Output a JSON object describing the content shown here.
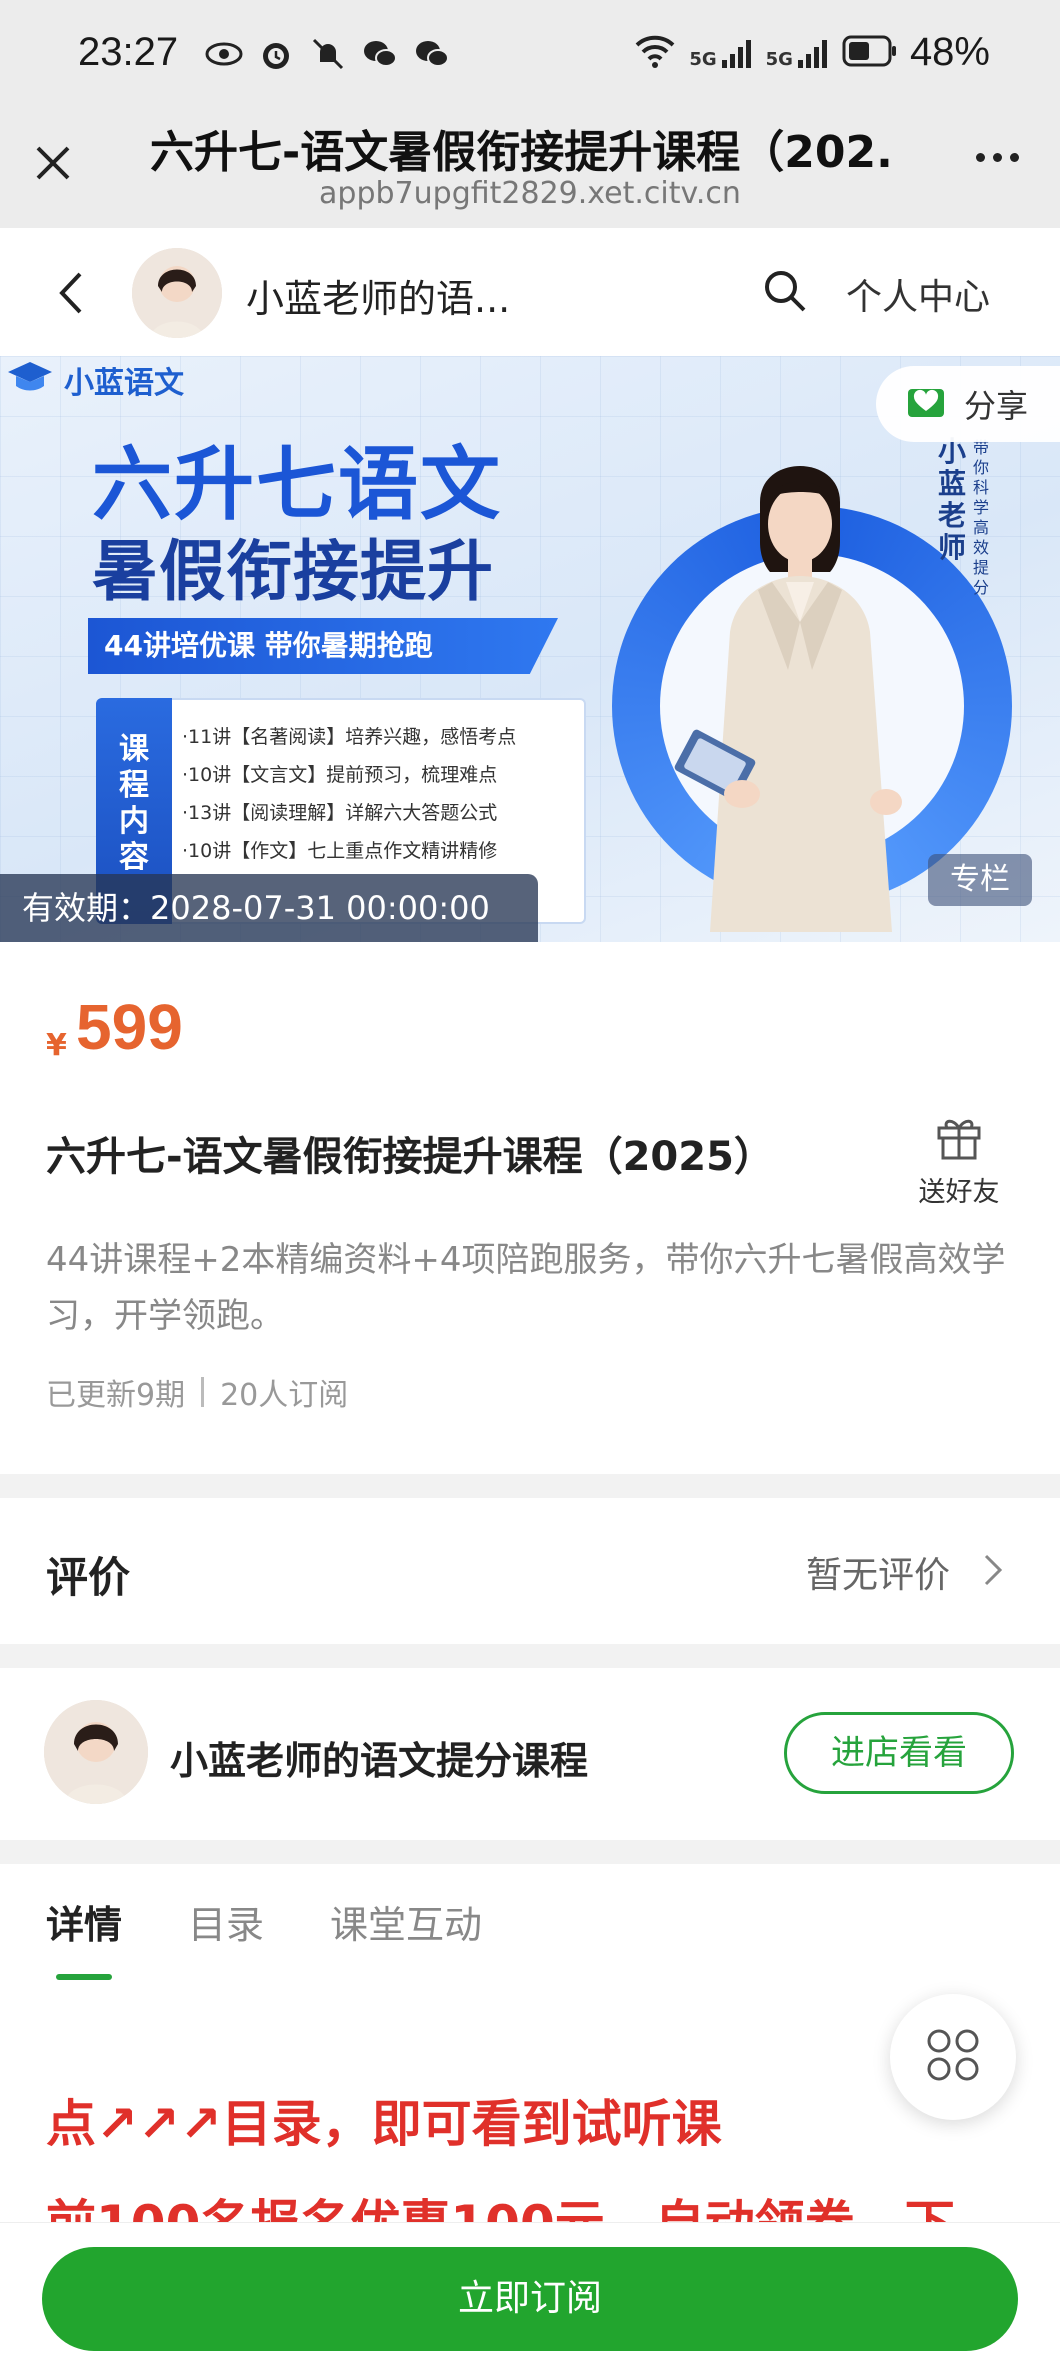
{
  "status_bar": {
    "time": "23:27",
    "battery": "48%",
    "network1": "5G",
    "network2": "5G"
  },
  "browser": {
    "title": "六升七-语文暑假衔接提升课程（202...",
    "url": "appb7upgfit2829.xet.citv.cn"
  },
  "shop_header": {
    "shop_name": "小蓝老师的语...",
    "personal_center": "个人中心"
  },
  "banner": {
    "brand": "小蓝语文",
    "title_line1": "六升七语文",
    "title_line2": "暑假衔接提升",
    "ribbon": "44讲培优课  带你暑期抢跑",
    "content_tab": "课程内容",
    "content_items": [
      "·11讲【名著阅读】培养兴趣，感悟考点",
      "·10讲【文言文】提前预习，梳理难点",
      "·13讲【阅读理解】详解六大答题公式",
      "·10讲【作文】七上重点作文精讲精修"
    ],
    "teacher_name": "小蓝老师",
    "teacher_slogan": "带你科学高效提分",
    "share": "分享",
    "validity": "有效期：2028-07-31 00:00:00",
    "badge": "专栏"
  },
  "product": {
    "currency": "¥",
    "price": "599",
    "title": "六升七-语文暑假衔接提升课程（2025）",
    "gift_label": "送好友",
    "description": "44讲课程+2本精编资料+4项陪跑服务，带你六升七暑假高效学习，开学领跑。",
    "updated": "已更新9期",
    "subscribers": "20人订阅"
  },
  "reviews": {
    "label": "评价",
    "value": "暂无评价"
  },
  "shop_row": {
    "name": "小蓝老师的语文提分课程",
    "visit_button": "进店看看"
  },
  "tabs": [
    "详情",
    "目录",
    "课堂互动"
  ],
  "detail": {
    "promo_line1": "点↗↗↗目录，即可看到试听课",
    "promo_line2": "前100名报名优惠100元，自动领券，下"
  },
  "bottom": {
    "subscribe": "立即订阅"
  },
  "colors": {
    "accent_green": "#22a52e",
    "price_orange": "#e6642f",
    "promo_red": "#e0302a"
  }
}
